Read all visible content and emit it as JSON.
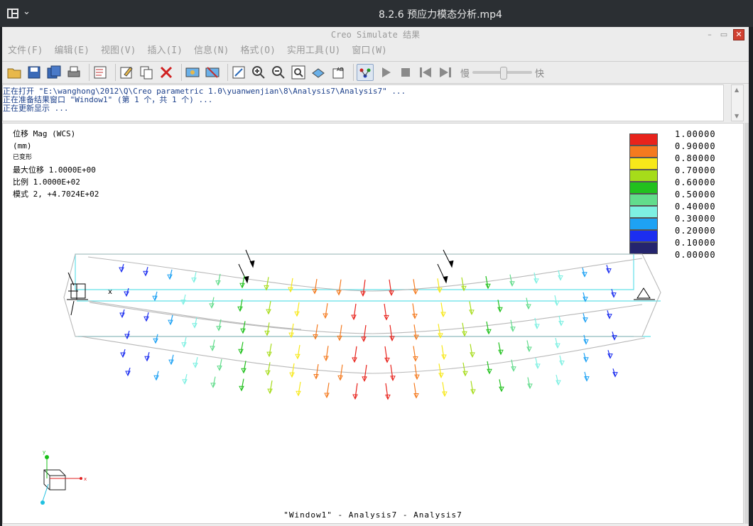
{
  "player": {
    "title": "8.2.6  预应力模态分析.mp4",
    "menu_icon": "grid-icon"
  },
  "app": {
    "title": "Creo Simulate 结果",
    "menus": [
      "文件(F)",
      "编辑(E)",
      "视图(V)",
      "插入(I)",
      "信息(N)",
      "格式(O)",
      "实用工具(U)",
      "窗口(W)"
    ],
    "speed_slow": "慢",
    "speed_fast": "快",
    "speed_level_fraction": 0.46
  },
  "messages": [
    "正在打开 \"E:\\wanghong\\2012\\Q\\Creo parametric 1.0\\yuanwenjian\\8\\Analysis7\\Analysis7\" ...",
    "正在准备结果窗口 \"Window1\" (第 1 个，共 1 个) ...",
    "正在更新显示 ..."
  ],
  "result": {
    "line1": "位移 Mag (WCS)",
    "line2": "(mm)",
    "line3": "已变形",
    "line4": "最大位移  1.0000E+00",
    "line5": "比例  1.0000E+02",
    "line6": "模式 2,  +4.7024E+02"
  },
  "legend": {
    "values": [
      "1.00000",
      "0.90000",
      "0.80000",
      "0.70000",
      "0.60000",
      "0.50000",
      "0.40000",
      "0.30000",
      "0.20000",
      "0.10000",
      "0.00000"
    ],
    "colors": [
      "#e8231c",
      "#f47a1f",
      "#f7e81a",
      "#a6dc1a",
      "#22c11e",
      "#62dc8c",
      "#7ef0e2",
      "#1ea2f4",
      "#1c2ef0",
      "#24246e"
    ]
  },
  "caption": "\"Window1\" - Analysis7 - Analysis7",
  "triad": {
    "x": "x",
    "y": "y"
  }
}
